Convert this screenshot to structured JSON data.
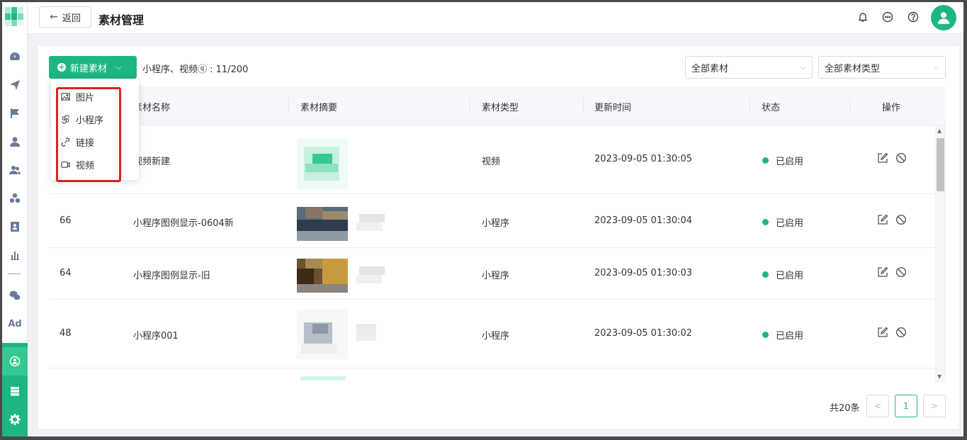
{
  "header": {
    "back_label": "返回",
    "title": "素材管理"
  },
  "toolbar": {
    "new_button_label": "新建素材",
    "quota_text": "小程序、视频ⓠ : 11/200",
    "filter_scope": "全部素材",
    "filter_type": "全部素材类型"
  },
  "dropdown": {
    "items": [
      {
        "label": "图片",
        "icon": "image-icon"
      },
      {
        "label": "小程序",
        "icon": "mini-program-icon"
      },
      {
        "label": "链接",
        "icon": "link-icon"
      },
      {
        "label": "视频",
        "icon": "video-icon"
      }
    ]
  },
  "table": {
    "columns": [
      "素材名称",
      "素材摘要",
      "素材类型",
      "更新时间",
      "状态",
      "操作"
    ],
    "rows": [
      {
        "id": "",
        "name": "视频新建",
        "type": "视频",
        "updated": "2023-09-05 01:30:05",
        "status": "已启用"
      },
      {
        "id": "66",
        "name": "小程序图例显示-0604新",
        "type": "小程序",
        "updated": "2023-09-05 01:30:04",
        "status": "已启用"
      },
      {
        "id": "64",
        "name": "小程序图例显示-旧",
        "type": "小程序",
        "updated": "2023-09-05 01:30:03",
        "status": "已启用"
      },
      {
        "id": "48",
        "name": "小程序001",
        "type": "小程序",
        "updated": "2023-09-05 01:30:02",
        "status": "已启用"
      }
    ]
  },
  "pagination": {
    "total_text": "共20条",
    "prev": "<",
    "current_page": "1",
    "next": ">"
  },
  "colors": {
    "accent": "#1db682",
    "highlight": "#e02020"
  }
}
